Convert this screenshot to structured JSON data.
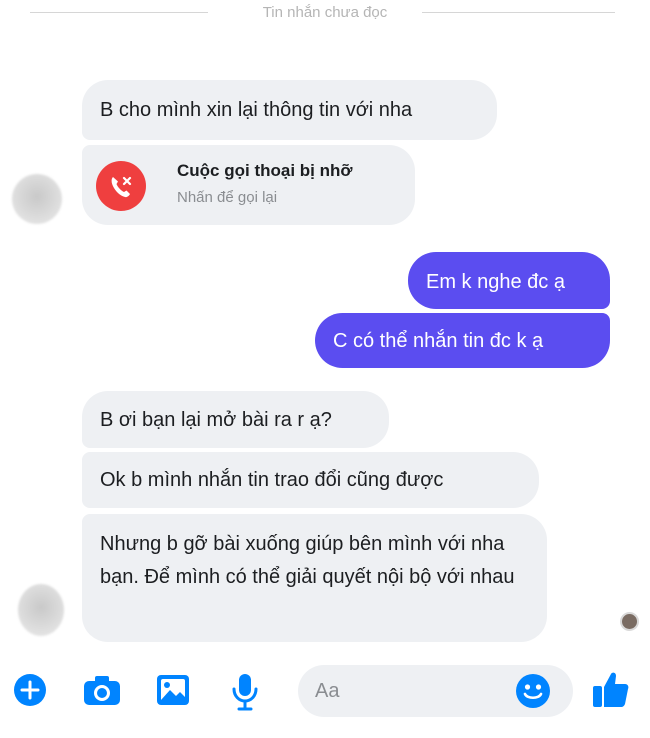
{
  "divider": {
    "label": "Tin nhắn chưa đọc"
  },
  "thread": {
    "msg_1": "B cho mình xin lại thông tin với nha",
    "missed_call": {
      "title": "Cuộc gọi thoại bị nhỡ",
      "subtitle": "Nhấn để gọi lại"
    },
    "reply_1": "Em k nghe đc ạ",
    "reply_2": "C có thể nhắn tin đc k ạ",
    "msg_2": "B ơi bạn lại mở bài ra r ạ?",
    "msg_3": "Ok b mình nhắn tin trao đổi cũng được",
    "msg_4": "Nhưng b gỡ bài xuống giúp bên mình với nha bạn. Để mình có thể giải quyết nội bộ với nhau"
  },
  "composer": {
    "placeholder": "Aa"
  },
  "colors": {
    "accent": "#0084ff",
    "outgoing_bubble": "#5b4df0",
    "incoming_bubble": "#eef0f3",
    "missed_call": "#ef3f3f"
  },
  "icons": [
    "plus-icon",
    "camera-icon",
    "image-icon",
    "microphone-icon",
    "emoji-icon",
    "thumbs-up-icon",
    "phone-missed-icon"
  ]
}
